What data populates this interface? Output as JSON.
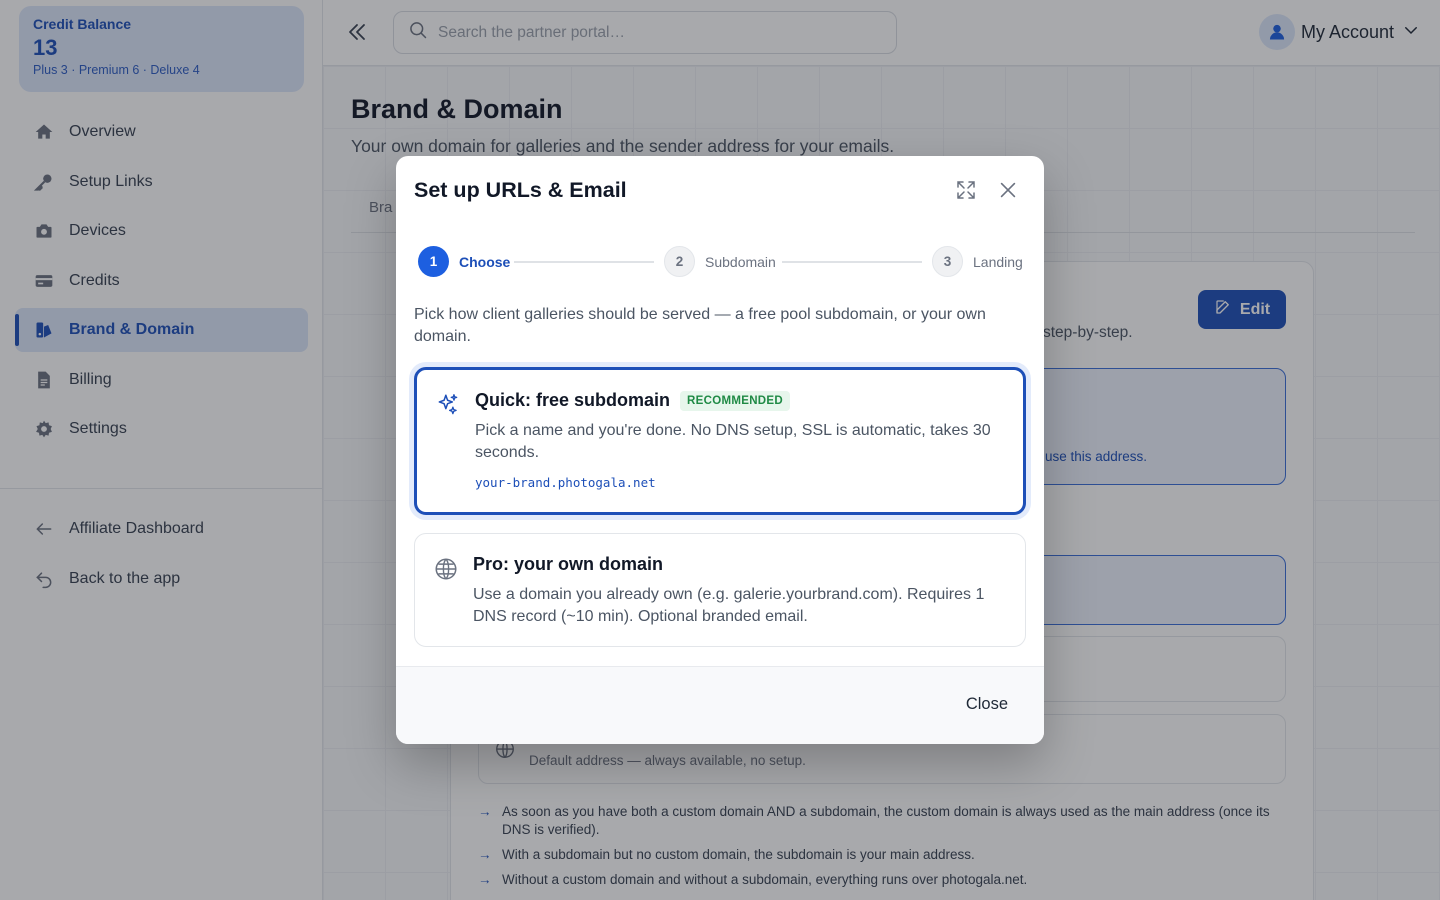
{
  "sidebar": {
    "credit": {
      "label": "Credit Balance",
      "value": "13",
      "breakdown": "Plus 3 · Premium 6 · Deluxe 4"
    },
    "items": [
      {
        "label": "Overview",
        "icon": "home-icon"
      },
      {
        "label": "Setup Links",
        "icon": "key-icon"
      },
      {
        "label": "Devices",
        "icon": "camera-icon"
      },
      {
        "label": "Credits",
        "icon": "credit-card-icon"
      },
      {
        "label": "Brand & Domain",
        "icon": "brand-icon",
        "active": true
      },
      {
        "label": "Billing",
        "icon": "document-icon"
      },
      {
        "label": "Settings",
        "icon": "gear-icon"
      }
    ],
    "footer_items": [
      {
        "label": "Affiliate Dashboard",
        "icon": "arrow-left-icon"
      },
      {
        "label": "Back to the app",
        "icon": "undo-icon"
      }
    ]
  },
  "topbar": {
    "search_placeholder": "Search the partner portal…",
    "account_label": "My Account"
  },
  "page": {
    "title": "Brand & Domain",
    "subtitle": "Your own domain for galleries and the sender address for your emails.",
    "tab_fragment": "Bra",
    "edit_label": "Edit",
    "bg_fragment_1": "step-by-step.",
    "bg_fragment_2": "use this address.",
    "bg_fragment_3": "Default address — always available, no setup.",
    "notes": [
      "As soon as you have both a custom domain AND a subdomain, the custom domain is always used as the main address (once its DNS is verified).",
      "With a subdomain but no custom domain, the subdomain is your main address.",
      "Without a custom domain and without a subdomain, everything runs over photogala.net."
    ]
  },
  "modal": {
    "title": "Set up URLs & Email",
    "steps": [
      {
        "number": "1",
        "label": "Choose"
      },
      {
        "number": "2",
        "label": "Subdomain"
      },
      {
        "number": "3",
        "label": "Landing"
      }
    ],
    "description": "Pick how client galleries should be served — a free pool subdomain, or your own domain.",
    "options": [
      {
        "title": "Quick: free subdomain",
        "badge": "RECOMMENDED",
        "text": "Pick a name and you're done. No DNS setup, SSL is automatic, takes 30 seconds.",
        "example": "your-brand.photogala.net",
        "icon": "sparkles-icon"
      },
      {
        "title": "Pro: your own domain",
        "text": "Use a domain you already own (e.g. galerie.yourbrand.com). Requires 1 DNS record (~10 min). Optional branded email.",
        "icon": "globe-icon"
      }
    ],
    "close_label": "Close"
  },
  "colors": {
    "accent": "#1d4fb8",
    "accent_light": "#dce7fb",
    "badge_bg": "#e7f6ec",
    "badge_text": "#1f8a45"
  }
}
